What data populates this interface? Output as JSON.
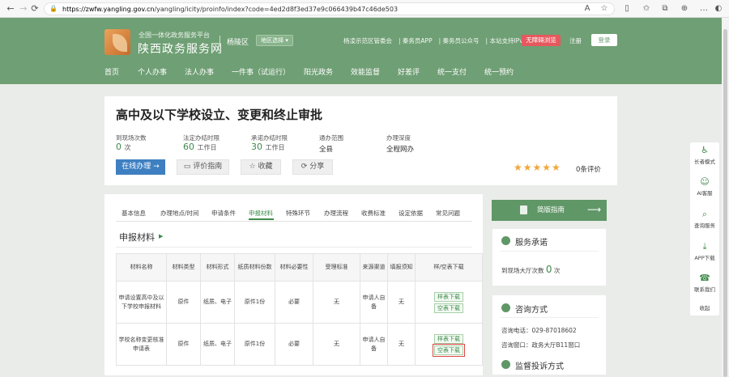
{
  "browser": {
    "url_host": "https://zwfw.yangling.gov.cn",
    "url_path": "/yangling/icity/proinfo/index?code=4ed2d8f3ed37e9c066439b47c46de503",
    "back_icon": "arrow-left",
    "forward_icon": "arrow-right",
    "reload_icon": "refresh"
  },
  "header": {
    "site_sub": "全国一体化政务服务平台",
    "site_title": "陕西政务服务网",
    "region": "杨陵区",
    "region_select": "地区选择",
    "links": [
      "杨凌示范区管委会",
      "秦务员APP",
      "秦务员公众号",
      "本站支持IPv6"
    ],
    "barrier_free": "无障碍浏览",
    "register": "注册",
    "login": "登录"
  },
  "menu": [
    "首页",
    "个人办事",
    "法人办事",
    "一件事（试运行）",
    "阳光政务",
    "效能监督",
    "好差评",
    "统一支付",
    "统一预约"
  ],
  "item": {
    "title": "高中及以下学校设立、变更和终止审批",
    "stats": [
      {
        "label": "到现场次数",
        "value": "0",
        "unit": "次"
      },
      {
        "label": "法定办结时限",
        "value": "60",
        "unit": "工作日"
      },
      {
        "label": "承诺办结时限",
        "value": "30",
        "unit": "工作日"
      },
      {
        "label": "通办范围",
        "value": "全县",
        "unit": ""
      },
      {
        "label": "办理深度",
        "value": "全程网办",
        "unit": ""
      }
    ],
    "online_btn": "在线办理",
    "guide_btn": "评价指南",
    "fav_btn": "收藏",
    "share_btn": "分享",
    "rating_stars": 5,
    "rating_text": "0条评价"
  },
  "tabs": [
    "基本信息",
    "办理地点/时间",
    "申请条件",
    "申报材料",
    "特殊环节",
    "办理流程",
    "收费标准",
    "设定依据",
    "常见问题"
  ],
  "active_tab": "申报材料",
  "section_title": "申报材料",
  "table": {
    "headers": [
      "材料名称",
      "材料类型",
      "材料形式",
      "纸质材料份数",
      "材料必要性",
      "受理标准",
      "来源渠道",
      "填报须知",
      "样/空表下载"
    ],
    "rows": [
      {
        "name": "申请设置高中及以下学校申报材料",
        "type": "原件",
        "form": "纸质、电子",
        "copies": "原件1份",
        "need": "必要",
        "standard": "无",
        "source": "申请人自备",
        "notice": "无",
        "sample": "样表下载",
        "blank": "空表下载"
      },
      {
        "name": "学校名称变更核准申请表",
        "type": "原件",
        "form": "纸质、电子",
        "copies": "原件1份",
        "need": "必要",
        "standard": "无",
        "source": "申请人自备",
        "notice": "无",
        "sample": "样表下载",
        "blank": "空表下载"
      }
    ]
  },
  "right": {
    "guide": "简版指南",
    "commit_title": "服务承诺",
    "commit_text": "到现场大厅次数",
    "commit_value": "0",
    "commit_unit": "次",
    "consult_title": "咨询方式",
    "consult_phone": "咨询电话：029-87018602",
    "consult_window": "咨询窗口：政务大厅B11窗口",
    "complaint_title": "监督投诉方式"
  },
  "side": [
    "长者模式",
    "AI客服",
    "查询服务",
    "APP下载",
    "联系我们",
    "收起"
  ],
  "colors": {
    "header": "#6f9f74",
    "accent": "#3e8a4a",
    "online": "#3e7fc1",
    "barrier": "#e6585e"
  }
}
